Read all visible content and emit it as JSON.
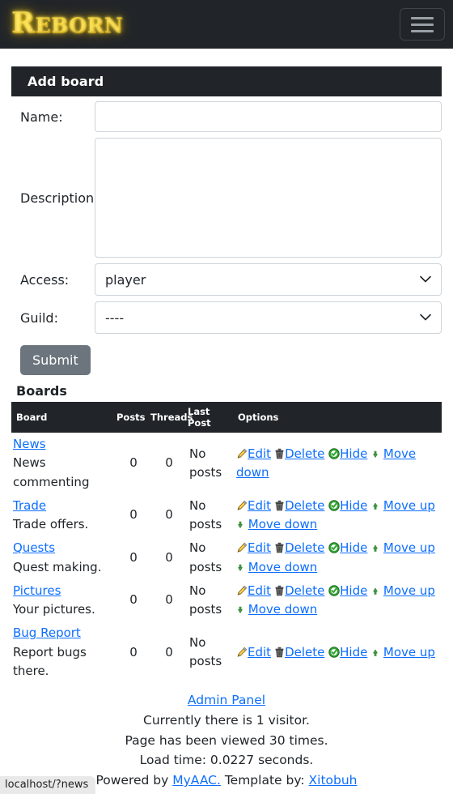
{
  "navbar": {
    "brand": "Reborn",
    "toggler_icon": "hamburger-icon"
  },
  "panel": {
    "title": "Add board"
  },
  "form": {
    "name": {
      "label": "Name:",
      "value": "",
      "placeholder": ""
    },
    "description": {
      "label": "Description:",
      "value": "",
      "placeholder": ""
    },
    "access": {
      "label": "Access:",
      "value": "player",
      "options": [
        "player"
      ]
    },
    "guild": {
      "label": "Guild:",
      "value": "----",
      "options": [
        "----"
      ]
    },
    "submit_label": "Submit"
  },
  "boards": {
    "title": "Boards",
    "columns": [
      "Board",
      "Posts",
      "Threads",
      "Last Post",
      "Options"
    ],
    "actions": {
      "edit": "Edit",
      "delete": "Delete",
      "hide": "Hide",
      "move_up": "Move up",
      "move_down": "Move down"
    },
    "icons": {
      "edit": "pencil-icon",
      "delete": "trash-icon",
      "hide": "green-check-circle-icon",
      "move_up": "green-arrow-up-icon",
      "move_down": "green-arrow-down-icon"
    },
    "rows": [
      {
        "name": "News",
        "description": "News commenting",
        "posts": "0",
        "threads": "0",
        "last_post": "No posts",
        "has_move_up": false,
        "has_move_down": true
      },
      {
        "name": "Trade",
        "description": "Trade offers.",
        "posts": "0",
        "threads": "0",
        "last_post": "No posts",
        "has_move_up": true,
        "has_move_down": true
      },
      {
        "name": "Quests",
        "description": "Quest making.",
        "posts": "0",
        "threads": "0",
        "last_post": "No posts",
        "has_move_up": true,
        "has_move_down": true
      },
      {
        "name": "Pictures",
        "description": "Your pictures.",
        "posts": "0",
        "threads": "0",
        "last_post": "No posts",
        "has_move_up": true,
        "has_move_down": true
      },
      {
        "name": "Bug Report",
        "description": "Report bugs there.",
        "posts": "0",
        "threads": "0",
        "last_post": "No posts",
        "has_move_up": true,
        "has_move_down": false
      }
    ]
  },
  "footer": {
    "admin_panel": "Admin Panel",
    "visitors": "Currently there is 1 visitor.",
    "views": "Page has been viewed 30 times.",
    "load_time": "Load time: 0.0227 seconds.",
    "powered_prefix": "Powered by ",
    "powered_link": "MyAAC.",
    "template_prefix": " Template by: ",
    "template_link": "Xitobuh"
  },
  "status_bar": {
    "url": "localhost/?news"
  },
  "colors": {
    "navbar_bg": "#212529",
    "brand_gold": "#ffc800",
    "link_blue": "#0d6efd",
    "submit_gray": "#6c757d",
    "hide_green": "#2aa02a"
  }
}
